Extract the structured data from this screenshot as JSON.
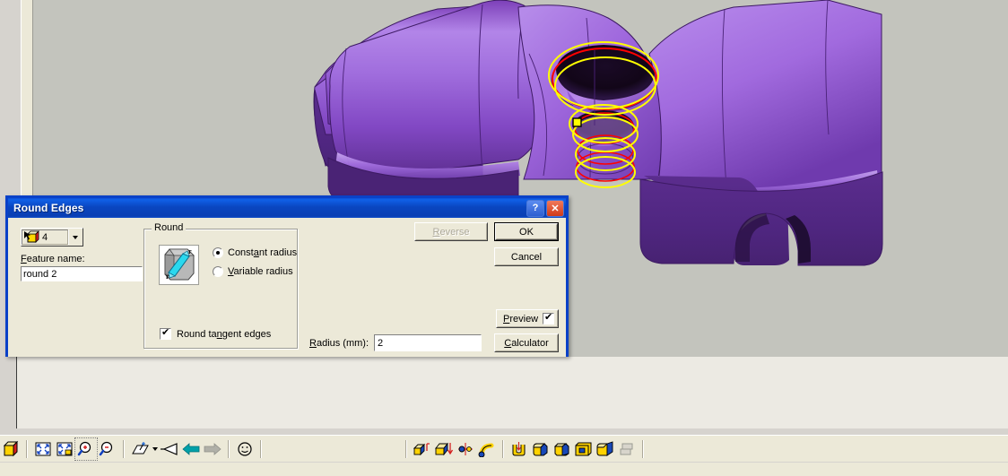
{
  "app": {
    "viewport_bg": "#c3c4bd",
    "model_color": "#9a5fd0",
    "highlight_colors": {
      "selected_edge": "#ffff00",
      "preview_edge": "#ff0000"
    }
  },
  "dialog": {
    "title": "Round Edges",
    "accent": "#0a41c8",
    "titlebar_buttons": [
      {
        "name": "help-button",
        "glyph": "?"
      },
      {
        "name": "close-button",
        "glyph": "✕"
      }
    ],
    "selection": {
      "count": "4",
      "icon": "select-edge-icon",
      "dropdown_icon": "chevron-down-icon"
    },
    "feature_name": {
      "label_pre": "F",
      "label_post": "eature name:",
      "value": "round 2"
    },
    "group": {
      "title": "Round",
      "preview_image": "round-edge-preview-icon",
      "options": [
        {
          "label_pre": "Const",
          "label_key": "a",
          "label_post": "nt radius",
          "selected": true
        },
        {
          "label_pre": "",
          "label_key": "V",
          "label_post": "ariable radius",
          "selected": false
        }
      ],
      "tangent": {
        "label_pre": "Round ta",
        "label_key": "n",
        "label_post": "gent edges",
        "checked": true
      }
    },
    "radius": {
      "label_pre": "R",
      "label_post": "adius (mm):",
      "value": "2"
    },
    "buttons": {
      "reverse": {
        "label_pre": "R",
        "label_post": "everse",
        "disabled": true
      },
      "ok": {
        "label": "OK",
        "default": true
      },
      "cancel": {
        "label": "Cancel"
      },
      "preview": {
        "label_pre": "P",
        "label_post": "review",
        "checked": true
      },
      "calculator": {
        "label_pre": "C",
        "label_post": "alculator"
      }
    }
  },
  "toolbar": {
    "groups": [
      {
        "name": "render-group",
        "items": [
          {
            "name": "shaded-render-icon",
            "glyph": "render"
          }
        ]
      },
      {
        "name": "zoom-group",
        "items": [
          {
            "name": "zoom-fit-icon",
            "glyph": "fit"
          },
          {
            "name": "zoom-window-icon",
            "glyph": "window"
          },
          {
            "name": "zoom-in-icon",
            "glyph": "zoom-in"
          },
          {
            "name": "zoom-out-icon",
            "glyph": "zoom-out"
          }
        ]
      },
      {
        "name": "view-group",
        "items": [
          {
            "name": "workplane-view-icon",
            "glyph": "plane"
          },
          {
            "name": "view-dropdown-icon",
            "glyph": "caret"
          },
          {
            "name": "camera-view-icon",
            "glyph": "camera"
          },
          {
            "name": "previous-view-icon",
            "glyph": "arrow-left"
          },
          {
            "name": "next-view-icon",
            "glyph": "arrow-right"
          }
        ]
      },
      {
        "name": "misc-group",
        "items": [
          {
            "name": "smiley-icon",
            "glyph": "smiley"
          }
        ]
      },
      {
        "name": "feature-group",
        "items": [
          {
            "name": "extrude-boss-icon",
            "glyph": "extrude"
          },
          {
            "name": "extrude-cut-icon",
            "glyph": "cut"
          },
          {
            "name": "revolve-icon",
            "glyph": "revolve"
          },
          {
            "name": "sweep-icon",
            "glyph": "sweep"
          }
        ]
      },
      {
        "name": "modify-group",
        "items": [
          {
            "name": "shell-icon",
            "glyph": "shell"
          },
          {
            "name": "round-edges-icon",
            "glyph": "round"
          },
          {
            "name": "chamfer-icon",
            "glyph": "chamfer"
          },
          {
            "name": "hollow-icon",
            "glyph": "hollow"
          },
          {
            "name": "draft-icon",
            "glyph": "draft"
          },
          {
            "name": "pattern-icon",
            "glyph": "pattern"
          }
        ]
      }
    ]
  }
}
